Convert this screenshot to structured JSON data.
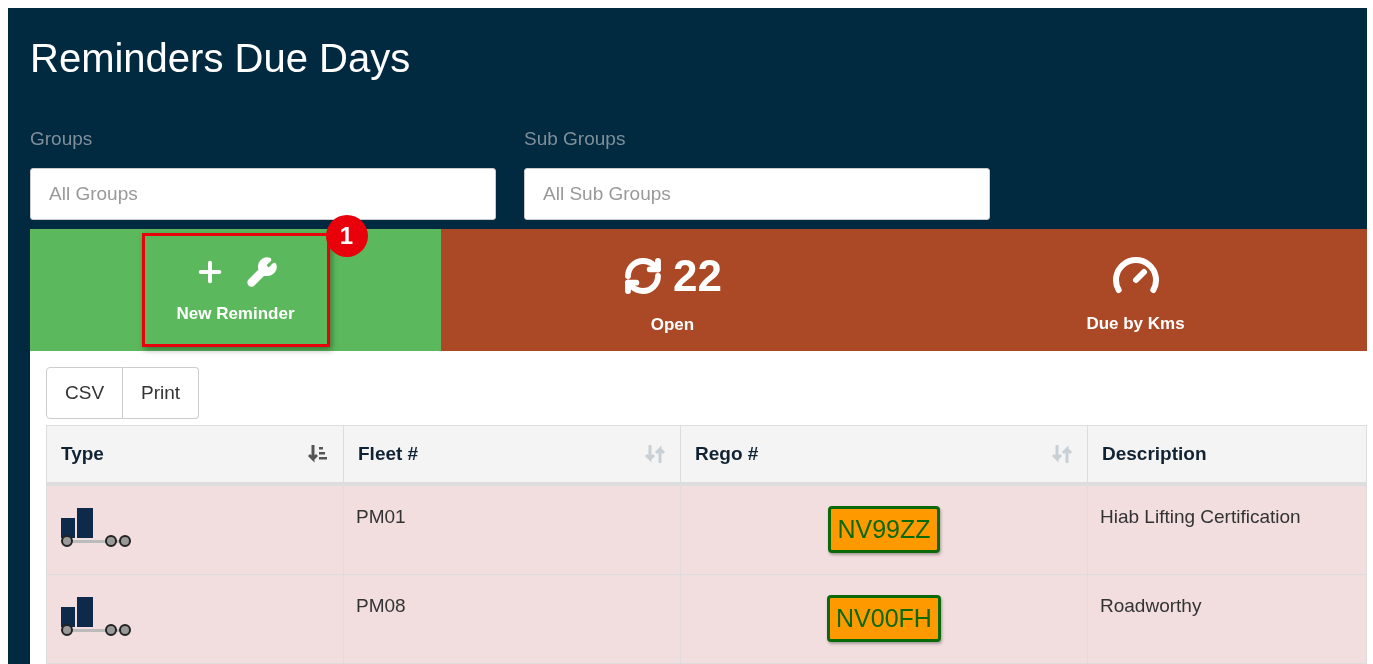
{
  "title": "Reminders Due Days",
  "filters": [
    {
      "label": "Groups",
      "placeholder": "All Groups"
    },
    {
      "label": "Sub Groups",
      "placeholder": "All Sub Groups"
    }
  ],
  "tiles": [
    {
      "kind": "new",
      "label": "New Reminder",
      "callout": "1"
    },
    {
      "kind": "open",
      "count": "22",
      "label": "Open"
    },
    {
      "kind": "kms",
      "label": "Due by Kms"
    }
  ],
  "export_buttons": [
    "CSV",
    "Print"
  ],
  "table": {
    "columns": [
      {
        "label": "Type",
        "sortable": true,
        "sorted": true
      },
      {
        "label": "Fleet #",
        "sortable": true,
        "sorted": false
      },
      {
        "label": "Rego #",
        "sortable": true,
        "sorted": false
      },
      {
        "label": "Description"
      }
    ],
    "rows": [
      {
        "fleet": "PM01",
        "rego": "NV99ZZ",
        "description": "Hiab Lifting Certification",
        "overdue": true
      },
      {
        "fleet": "PM08",
        "rego": "NV00FH",
        "description": "Roadworthy",
        "overdue": true
      }
    ]
  }
}
